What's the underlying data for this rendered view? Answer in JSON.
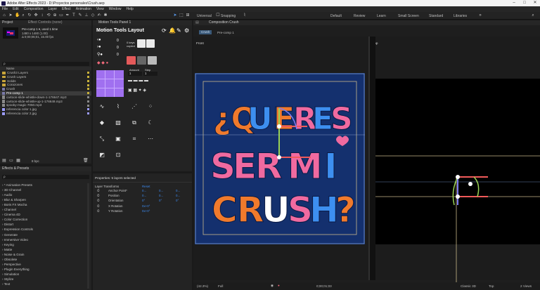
{
  "app_title": "Adobe After Effects 2023 - D:\\Proyectos personales\\Crush.aep",
  "menu": [
    "File",
    "Edit",
    "Composition",
    "Layer",
    "Effect",
    "Animation",
    "View",
    "Window",
    "Help"
  ],
  "toolbar": {
    "universal": "Universal",
    "snapping": "Snapping",
    "workspaces": [
      "Default",
      "Review",
      "Learn",
      "Small Screen",
      "Standard",
      "Libraries"
    ],
    "active_workspace": "Default"
  },
  "project_panel": {
    "tab_project": "Project",
    "tab_effect_controls": "Effect Controls (none)",
    "selected_name": "Pre-comp 1 ▾, used 1 time",
    "selected_size": "1480 x 1480 (1.00)",
    "selected_duration": "Δ 0;00;06;01, 15.00 fps",
    "search_placeholder": "ρ",
    "name_header": "Name",
    "items": [
      {
        "name": "Crush3 Layers",
        "kind": "folder",
        "color": "#c9b23a"
      },
      {
        "name": "Crush Layers",
        "kind": "folder",
        "color": "#c9b23a"
      },
      {
        "name": "Solids",
        "kind": "folder",
        "color": "#c9b23a"
      },
      {
        "name": "Corazones",
        "kind": "folder",
        "color": "#c9b23a"
      },
      {
        "name": "Crush",
        "kind": "comp",
        "color": "#c9b23a"
      },
      {
        "name": "Pre-comp 1",
        "kind": "comp",
        "color": "#c9b23a",
        "selected": true
      },
      {
        "name": "cartoon-slide-whistle-down-1-176647.mp3",
        "kind": "audio",
        "color": "#8a8a8a"
      },
      {
        "name": "cartoon-slide-whistle-up-1-176649.mp3",
        "kind": "audio",
        "color": "#8a8a8a"
      },
      {
        "name": "spooky-magic-7050.mp3",
        "kind": "audio",
        "color": "#8a8a8a"
      },
      {
        "name": "referencia color 1.jpg",
        "kind": "image",
        "color": "#9c9cff"
      },
      {
        "name": "referencia color 2.jpg",
        "kind": "image",
        "color": "#9c9cff"
      }
    ],
    "bpc": "8 bpc"
  },
  "effects_panel": {
    "title": "Effects & Presets",
    "search_placeholder": "ρ",
    "items": [
      "* Animation Presets",
      "3D Channel",
      "Audio",
      "Blur & Sharpen",
      "Boris FX Mocha",
      "Channel",
      "Cinema 4D",
      "Color Correction",
      "Distort",
      "Expression Controls",
      "Generate",
      "Immersive Video",
      "Keying",
      "Matte",
      "Noise & Grain",
      "Obsolete",
      "Perspective",
      "Plugin Everything",
      "Simulation",
      "Stylize",
      "Text"
    ]
  },
  "motion_tools": {
    "tab": "Motion Tools Panel 1",
    "title": "Motion Tools Layout",
    "counters": [
      "0",
      "0",
      "0"
    ],
    "keys_copied_label": "0 keys copied",
    "amount_label": "Amount",
    "amount_value": "1",
    "step_label": "Step",
    "step_value": "1"
  },
  "properties": {
    "title": "Properties: 5 layers selected",
    "section": "Layer Transforms",
    "reset": "Reset",
    "rows": [
      {
        "name": "Anchor Point*",
        "v1": "0...",
        "v2": "0...",
        "v3": "0..."
      },
      {
        "name": "Position",
        "v1": "0...",
        "v2": "0...",
        "v3": "0..."
      },
      {
        "name": "Orientation",
        "v1": "0°",
        "v2": "0°",
        "v3": "0°"
      },
      {
        "name": "X Rotation",
        "v1": "0x+0°",
        "v2": "",
        "v3": ""
      },
      {
        "name": "Y Rotation",
        "v1": "0x+0°",
        "v2": "",
        "v3": ""
      }
    ]
  },
  "composition": {
    "tab": "Composition Crush",
    "tab_name_highlight": "Crush",
    "breadcrumb": [
      "Crush",
      "Pre-comp 1"
    ],
    "view_front_label": "Front",
    "view_top_label": "Top",
    "artwork_lines": [
      {
        "text": "¿QUIERES",
        "colors": [
          "#f07a2c",
          "#3d8ff0",
          "#f06aa0",
          "#3d8ff0",
          "#f07a2c",
          "#f06aa0",
          "#3d8ff0",
          "#f07a2c"
        ]
      },
      {
        "text": "SER MI",
        "colors": [
          "#f06aa0",
          "#f07a2c",
          "#3d8ff0",
          "#f06aa0",
          "#f07a2c",
          "#3d8ff0"
        ]
      },
      {
        "text": "CRUSH?",
        "colors": [
          "#f07a2c",
          "#3d8ff0",
          "#ffffff",
          "#f06aa0",
          "#3d8ff0",
          "#f07a2c"
        ]
      }
    ],
    "artwork_bg": "#14306e",
    "footer": {
      "zoom": "(42.3%)",
      "resolution": "Full",
      "timecode": "0;00;01;03",
      "renderer": "Classic 3D",
      "view": "Top",
      "views": "2 Views"
    }
  }
}
